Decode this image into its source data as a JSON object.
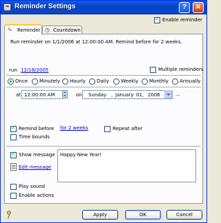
{
  "window": {
    "title": "Reminder Settings",
    "help_glyph": "?",
    "close_glyph": "✕",
    "enable_reminder": {
      "label": "Enable reminder",
      "checked": true
    }
  },
  "tabs": [
    {
      "label": "Reminder",
      "active": true
    },
    {
      "label": "Countdown",
      "active": false
    }
  ],
  "summary": "Run reminder on 1/1/2006 at 12:00:00 AM.  Remind before for 2 weeks.",
  "run": {
    "label": "run",
    "date_link": "12/18/2005",
    "multiple_reminders": {
      "label": "Multiple reminders",
      "checked": false
    }
  },
  "frequency": {
    "options": [
      "Once",
      "Minutely",
      "Hourly",
      "Daily",
      "Weekly",
      "Monthly",
      "Annually"
    ],
    "selected": "Once"
  },
  "at": {
    "label": "at",
    "time_value": "12:00:00 AM",
    "on_label": "on",
    "date_day": "Sunday",
    "date_sep1": ",",
    "date_month": "January",
    "date_daynum": "01,",
    "date_year": "2006",
    "ellipsis": "..."
  },
  "remind_before": {
    "label": "Remind before",
    "checked": true,
    "link": "for 2 weeks"
  },
  "repeat_after": {
    "label": "Repeat after",
    "checked": false
  },
  "time_bounds": {
    "label": "Time bounds",
    "checked": false
  },
  "message": {
    "show_label": "Show message",
    "show_checked": true,
    "edit_link": "Edit message",
    "text": "Happy New Year!"
  },
  "play_sound": {
    "label": "Play sound",
    "checked": false
  },
  "enable_actions": {
    "label": "Enable actions",
    "checked": false
  },
  "buttons": {
    "apply": "Apply",
    "ok": "OK",
    "cancel": "Cancel"
  }
}
